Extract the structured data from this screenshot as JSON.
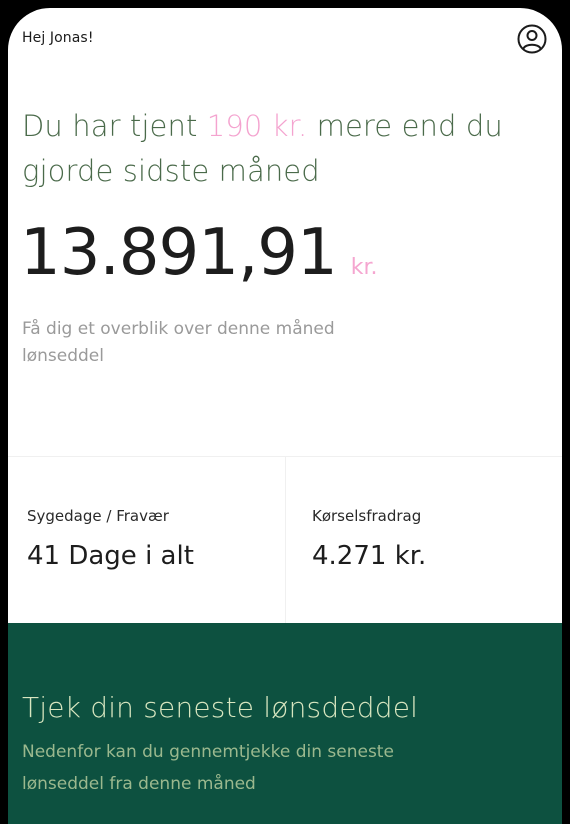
{
  "header": {
    "greeting": "Hej Jonas!",
    "profile_icon": "user-circle-icon"
  },
  "summary": {
    "headline_prefix": "Du har tjent ",
    "headline_amount": "190 kr.",
    "headline_suffix": " mere end du gjorde sidste måned",
    "total_amount": "13.891,91",
    "currency": "kr.",
    "description": "Få dig et overblik over denne måned lønseddel"
  },
  "stats": [
    {
      "label": "Sygedage / Fravær",
      "value": "41 Dage i alt"
    },
    {
      "label": "Kørselsfradrag",
      "value": "4.271 kr."
    }
  ],
  "promo": {
    "title": "Tjek din seneste lønsdeddel",
    "text": "Nedenfor kan du gennemtjekke din seneste lønseddel fra denne måned"
  },
  "colors": {
    "accent_pink": "#f4a3cf",
    "headline_green": "#4a6a4a",
    "promo_bg": "#0d5140",
    "promo_title": "#d8e6c0",
    "promo_text": "#9bb88e"
  }
}
